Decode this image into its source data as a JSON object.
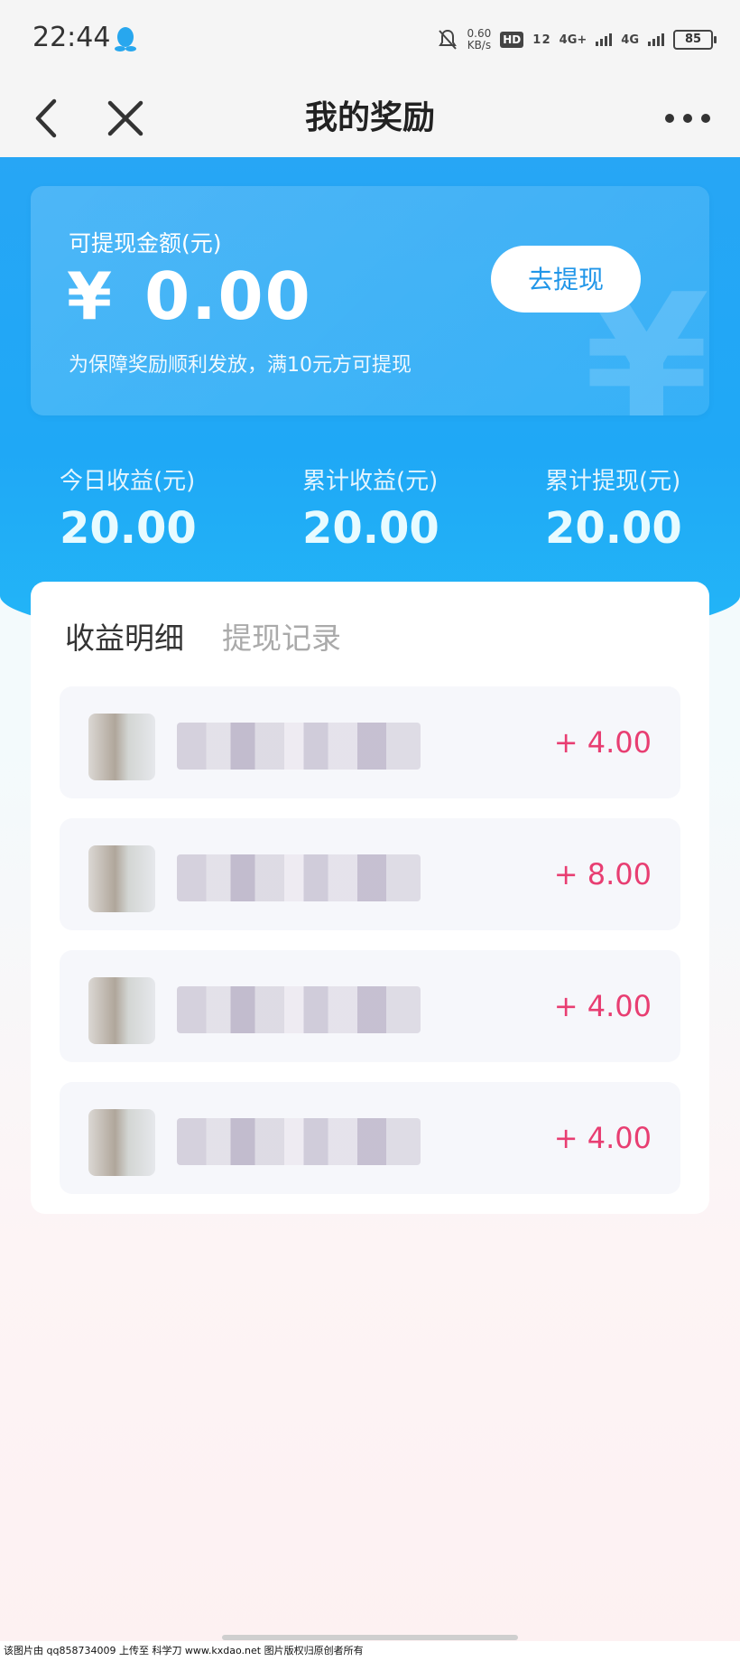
{
  "status_bar": {
    "time": "22:44",
    "speed_value": "0.60",
    "speed_unit": "KB/s",
    "hd_label": "HD",
    "hd_sub": "1 2",
    "net1": "4G+",
    "net2": "4G",
    "battery": "85"
  },
  "navbar": {
    "title": "我的奖励"
  },
  "balance": {
    "label": "可提现金额(元)",
    "currency": "¥",
    "amount": "0.00",
    "withdraw_button": "去提现",
    "tip": "为保障奖励顺利发放，满10元方可提现"
  },
  "stats": [
    {
      "label": "今日收益(元)",
      "value": "20.00"
    },
    {
      "label": "累计收益(元)",
      "value": "20.00"
    },
    {
      "label": "累计提现(元)",
      "value": "20.00"
    }
  ],
  "tabs": [
    {
      "label": "收益明细",
      "active": true
    },
    {
      "label": "提现记录",
      "active": false
    }
  ],
  "records": [
    {
      "amount": "+ 4.00"
    },
    {
      "amount": "+ 8.00"
    },
    {
      "amount": "+ 4.00"
    },
    {
      "amount": "+ 4.00"
    }
  ],
  "colors": {
    "accent_blue": "#1fa8f6",
    "income_red": "#e83e72",
    "button_text": "#2196e8"
  },
  "footer_watermark": "该图片由 qq858734009 上传至 科学刀 www.kxdao.net 图片版权归原创者所有"
}
